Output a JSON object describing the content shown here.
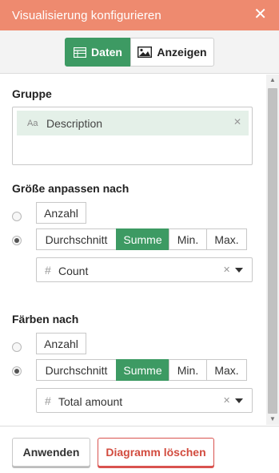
{
  "header": {
    "title": "Visualisierung konfigurieren",
    "close_icon": "close-icon"
  },
  "tabs": [
    {
      "label": "Daten",
      "icon": "table-icon",
      "active": true
    },
    {
      "label": "Anzeigen",
      "icon": "image-icon",
      "active": false
    }
  ],
  "group": {
    "title": "Gruppe",
    "chip": {
      "type_glyph": "Aa",
      "label": "Description"
    }
  },
  "size_section": {
    "title": "Größe anpassen nach",
    "count_label": "Anzahl",
    "agg_options": [
      "Durchschnitt",
      "Summe",
      "Min.",
      "Max."
    ],
    "selected_agg": "Summe",
    "selected_radio": "aggregate",
    "field": {
      "glyph": "#",
      "value": "Count"
    }
  },
  "color_section": {
    "title": "Färben nach",
    "count_label": "Anzahl",
    "agg_options": [
      "Durchschnitt",
      "Summe",
      "Min.",
      "Max."
    ],
    "selected_agg": "Summe",
    "selected_radio": "aggregate",
    "field": {
      "glyph": "#",
      "value": "Total amount"
    }
  },
  "footer": {
    "apply_label": "Anwenden",
    "delete_label": "Diagramm löschen"
  },
  "colors": {
    "header": "#ee8a6f",
    "accent": "#3d9a63",
    "danger": "#d24b3e"
  }
}
